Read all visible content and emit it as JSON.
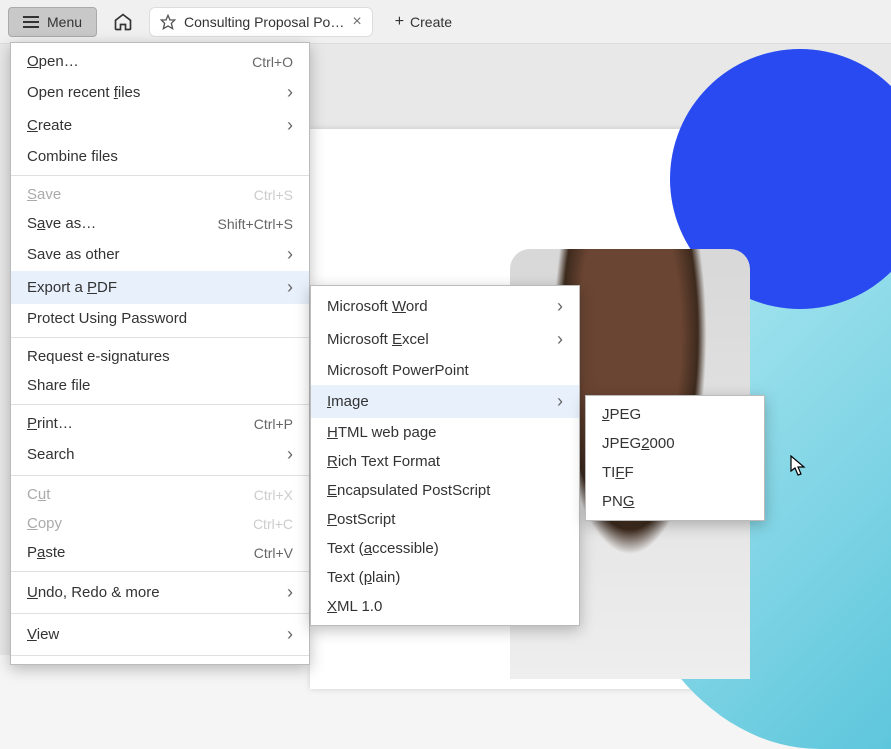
{
  "toolbar": {
    "menu_label": "Menu",
    "tab_title": "Consulting Proposal Po…",
    "create_label": "Create"
  },
  "main_menu": [
    {
      "label": "Open…",
      "underline": "O",
      "right": "Ctrl+O",
      "disabled": false
    },
    {
      "label": "Open recent files",
      "underline": "f",
      "submenu": true
    },
    {
      "label": "Create",
      "underline": "C",
      "submenu": true
    },
    {
      "label": "Combine files"
    },
    {
      "sep": true
    },
    {
      "label": "Save",
      "underline": "S",
      "right": "Ctrl+S",
      "disabled": true
    },
    {
      "label": "Save as…",
      "underline": "a",
      "right": "Shift+Ctrl+S"
    },
    {
      "label": "Save as other",
      "submenu": true
    },
    {
      "label": "Export a PDF",
      "underline": "P",
      "submenu": true,
      "hovered": true
    },
    {
      "label": "Protect Using Password"
    },
    {
      "sep": true
    },
    {
      "label": "Request e-signatures"
    },
    {
      "label": "Share file"
    },
    {
      "sep": true
    },
    {
      "label": "Print…",
      "underline": "P",
      "right": "Ctrl+P"
    },
    {
      "label": "Search",
      "submenu": true
    },
    {
      "sep": true
    },
    {
      "label": "Cut",
      "underline": "u",
      "right": "Ctrl+X",
      "disabled": true
    },
    {
      "label": "Copy",
      "underline": "C",
      "right": "Ctrl+C",
      "disabled": true
    },
    {
      "label": "Paste",
      "underline": "a",
      "right": "Ctrl+V"
    },
    {
      "sep": true
    },
    {
      "label": "Undo, Redo & more",
      "underline": "U",
      "submenu": true
    },
    {
      "sep": true
    },
    {
      "label": "View",
      "underline": "V",
      "submenu": true
    },
    {
      "sep": true
    }
  ],
  "export_submenu": [
    {
      "label": "Microsoft Word",
      "underline": "W",
      "submenu": true
    },
    {
      "label": "Microsoft Excel",
      "underline": "E",
      "submenu": true
    },
    {
      "label": "Microsoft PowerPoint"
    },
    {
      "label": "Image",
      "underline": "I",
      "submenu": true,
      "hovered": true
    },
    {
      "label": "HTML web page",
      "underline": "H"
    },
    {
      "label": "Rich Text Format",
      "underline": "R"
    },
    {
      "label": "Encapsulated PostScript",
      "underline": "E"
    },
    {
      "label": "PostScript",
      "underline": "P"
    },
    {
      "label": "Text (accessible)",
      "underline": "a"
    },
    {
      "label": "Text (plain)",
      "underline": "p"
    },
    {
      "label": "XML 1.0",
      "underline": "X"
    }
  ],
  "image_submenu": [
    {
      "label": "JPEG",
      "underline": "J"
    },
    {
      "label": "JPEG2000",
      "underline": "2"
    },
    {
      "label": "TIFF",
      "underline": "F"
    },
    {
      "label": "PNG",
      "underline": "G"
    }
  ]
}
